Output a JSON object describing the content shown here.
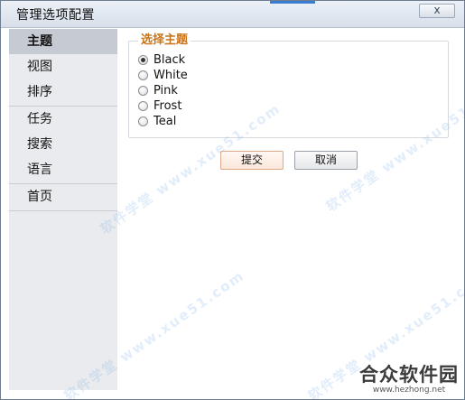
{
  "window": {
    "title": "管理选项配置",
    "close_glyph": "x"
  },
  "sidebar": {
    "items": [
      {
        "label": "主题",
        "active": true
      },
      {
        "label": "视图"
      },
      {
        "label": "排序"
      },
      {
        "label": "任务"
      },
      {
        "label": "搜索"
      },
      {
        "label": "语言"
      },
      {
        "label": "首页"
      }
    ]
  },
  "theme_group": {
    "title": "选择主题",
    "selected": "Black",
    "options": [
      "Black",
      "White",
      "Pink",
      "Frost",
      "Teal"
    ]
  },
  "actions": {
    "submit_label": "提交",
    "cancel_label": "取消"
  },
  "watermark": {
    "text": "软件学堂 www.xue51.com"
  },
  "brand": {
    "name": "合众软件园",
    "url": "www.hezhong.net"
  },
  "colors": {
    "group_title": "#c8741a",
    "sidebar_bg": "#e9ebee",
    "sidebar_active": "#c6cbd3",
    "accent": "#3b7ed1"
  }
}
